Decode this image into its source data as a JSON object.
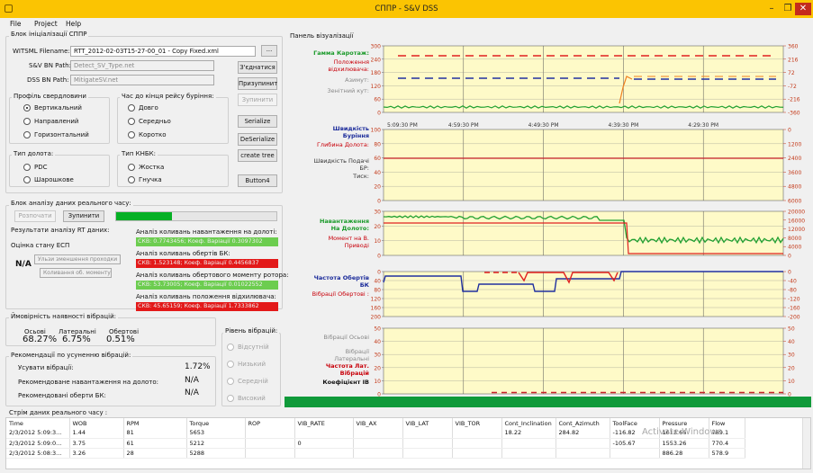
{
  "window": {
    "title": "СППР - S&V DSS",
    "minimize": "–",
    "maximize": "❐",
    "close": "✕"
  },
  "menu": {
    "file": "File",
    "project": "Project",
    "help": "Help"
  },
  "init": {
    "group_title": "Блок ініціалізації СППР",
    "witsml_label": "WITSML Filename:",
    "witsml_value": "RTT_2012-02-03T15-27-00_01 - Copy Fixed.xml",
    "browse_label": "...",
    "sv_bn_label": "S&V BN Path:",
    "sv_bn_value": "Detect_SV_Type.net",
    "dss_bn_label": "DSS BN Path:",
    "dss_bn_value": "MitigateSV.net",
    "connect_btn": "З'єднатися",
    "pause_btn": "Призупинит",
    "stop_btn": "Зупинити",
    "serialize_btn": "Serialize",
    "deserialize_btn": "DeSerialize",
    "create_tree_btn": "create tree",
    "button4": "Button4"
  },
  "profile": {
    "title": "Профіль свердловини",
    "options": [
      "Вертикальний",
      "Направлений",
      "Горизонтальний"
    ],
    "selected": 0
  },
  "time_left": {
    "title": "Час до кінця рейсу буріння:",
    "options": [
      "Довго",
      "Середньо",
      "Коротко"
    ]
  },
  "bit_type": {
    "title": "Тип долота:",
    "options": [
      "PDC",
      "Шарошкове"
    ]
  },
  "bha_type": {
    "title": "Тип КНБК:",
    "options": [
      "Жостка",
      "Гнучка"
    ]
  },
  "rt": {
    "group_title": "Блок аналізу даних реального часу:",
    "start_btn": "Розпочати",
    "stop_btn": "Зупинити",
    "progress": 0.35,
    "results_title": "Результати аналізу RT даних:",
    "ecp_label": "Оцінка стану ЕСП",
    "ecp_value": "N/A",
    "hint1": "Ульзи зменшення проходки",
    "hint2": "Коливання об. моменту",
    "a1_label": "Аналіз коливань навантаження на долоті:",
    "a1_value": "СКВ: 0.7743456; Коеф. Варіації 0.3097302",
    "a2_label": "Аналіз коливань обертів БК:",
    "a2_value": "СКВ: 1.523148; Коеф. Варіації 0.4456837",
    "a3_label": "Аналіз коливань обертового моменту ротора:",
    "a3_value": "СКВ: 53.73005; Коеф. Варіації 0.01022552",
    "a4_label": "Аналіз коливань положення відхилювача:",
    "a4_value": "СКВ: 45.65159; Коеф. Варіації 1.7333862"
  },
  "vib": {
    "title": "Ймовірність наявності вібрацій:",
    "axial_label": "Осьові",
    "lateral_label": "Латеральні",
    "torsional_label": "Обертові",
    "axial_value": "68.27%",
    "lateral_value": "6.75%",
    "torsional_value": "0.51%",
    "level_title": "Рівень вібрацій:",
    "levels": [
      "Відсутній",
      "Низький",
      "Середній",
      "Високий"
    ]
  },
  "rec": {
    "title": "Рекомендації по усуненню вібрацій:",
    "r1_label": "Усувати вібрації:",
    "r1_value": "1.72%",
    "r2_label": "Рекомендоване навантаження на долото:",
    "r2_value": "N/A",
    "r3_label": "Рекомендовані оберти БК:",
    "r3_value": "N/A"
  },
  "viz": {
    "title": "Панель візуалізації",
    "p1_labels": [
      "Гамма Каротаж:",
      "Положення відхилювача:",
      "Азимут:",
      "Зенітний кут:"
    ],
    "p2_labels": [
      "Швидкість Буріння",
      "Глибина Долота:",
      "Швидкість Подачі БР:",
      "Тиск:"
    ],
    "p3_labels": [
      "Навантаження На Долото:",
      "Момент на В. Приводі"
    ],
    "p4_labels": [
      "Частота Обертів БК",
      "Вібрації Обертові :"
    ],
    "p5_labels": [
      "Вібрації Осьові",
      "Вібрації Латеральні",
      "Частота Лат. Вібрацій",
      "Коефіцієнт ІВ"
    ],
    "time_ticks": [
      "5:09:30 PM",
      "4:59:30 PM",
      "4:49:30 PM",
      "4:39:30 PM",
      "4:29:30 PM"
    ],
    "p1_left_ticks": [
      "300",
      "240",
      "180",
      "120",
      "60",
      "0"
    ],
    "p1_right_ticks": [
      "360",
      "216",
      "72",
      "-72",
      "-216",
      "-360"
    ],
    "p2_left_ticks": [
      "100",
      "80",
      "60",
      "40",
      "20",
      "0"
    ],
    "p2_right_ticks": [
      "0",
      "1200",
      "2400",
      "3600",
      "4800",
      "6000"
    ],
    "p3_left_ticks": [
      "30",
      "20",
      "10",
      "0"
    ],
    "p3_right_ticks": [
      "20000",
      "16000",
      "12000",
      "8000",
      "4000",
      "0"
    ],
    "p4_left_ticks": [
      "0",
      "40",
      "80",
      "120",
      "160",
      "200"
    ],
    "p4_right_ticks": [
      "0",
      "-40",
      "-80",
      "-120",
      "-160",
      "-200"
    ],
    "p5_left_ticks": [
      "50",
      "40",
      "30",
      "20",
      "10",
      "0"
    ],
    "p5_right_ticks": [
      "50",
      "40",
      "30",
      "20",
      "10",
      "0"
    ]
  },
  "stream": {
    "title": "Стрім даних реального часу :",
    "columns": [
      "Time",
      "WOB",
      "RPM",
      "Torque",
      "ROP",
      "VIB_RATE",
      "VIB_AX",
      "VIB_LAT",
      "VIB_TOR",
      "Cont_Inclination",
      "Cont_Azimuth",
      "ToolFace",
      "Pressure",
      "Flow"
    ],
    "rows": [
      [
        "2/3/2012 5:09:3...",
        "1.44",
        "81",
        "5653",
        "",
        "",
        "",
        "",
        "",
        "18.22",
        "284.82",
        "-116.82",
        "1613.66",
        "789.1"
      ],
      [
        "2/3/2012 5:09:0...",
        "3.75",
        "61",
        "5212",
        "",
        "0",
        "",
        "",
        "",
        "",
        "",
        "-105.67",
        "1553.26",
        "770.4"
      ],
      [
        "2/3/2012 5:08:3...",
        "3.26",
        "28",
        "5288",
        "",
        "",
        "",
        "",
        "",
        "",
        "",
        "",
        "886.28",
        "578.9"
      ]
    ],
    "watermark": "Activate Windows"
  }
}
